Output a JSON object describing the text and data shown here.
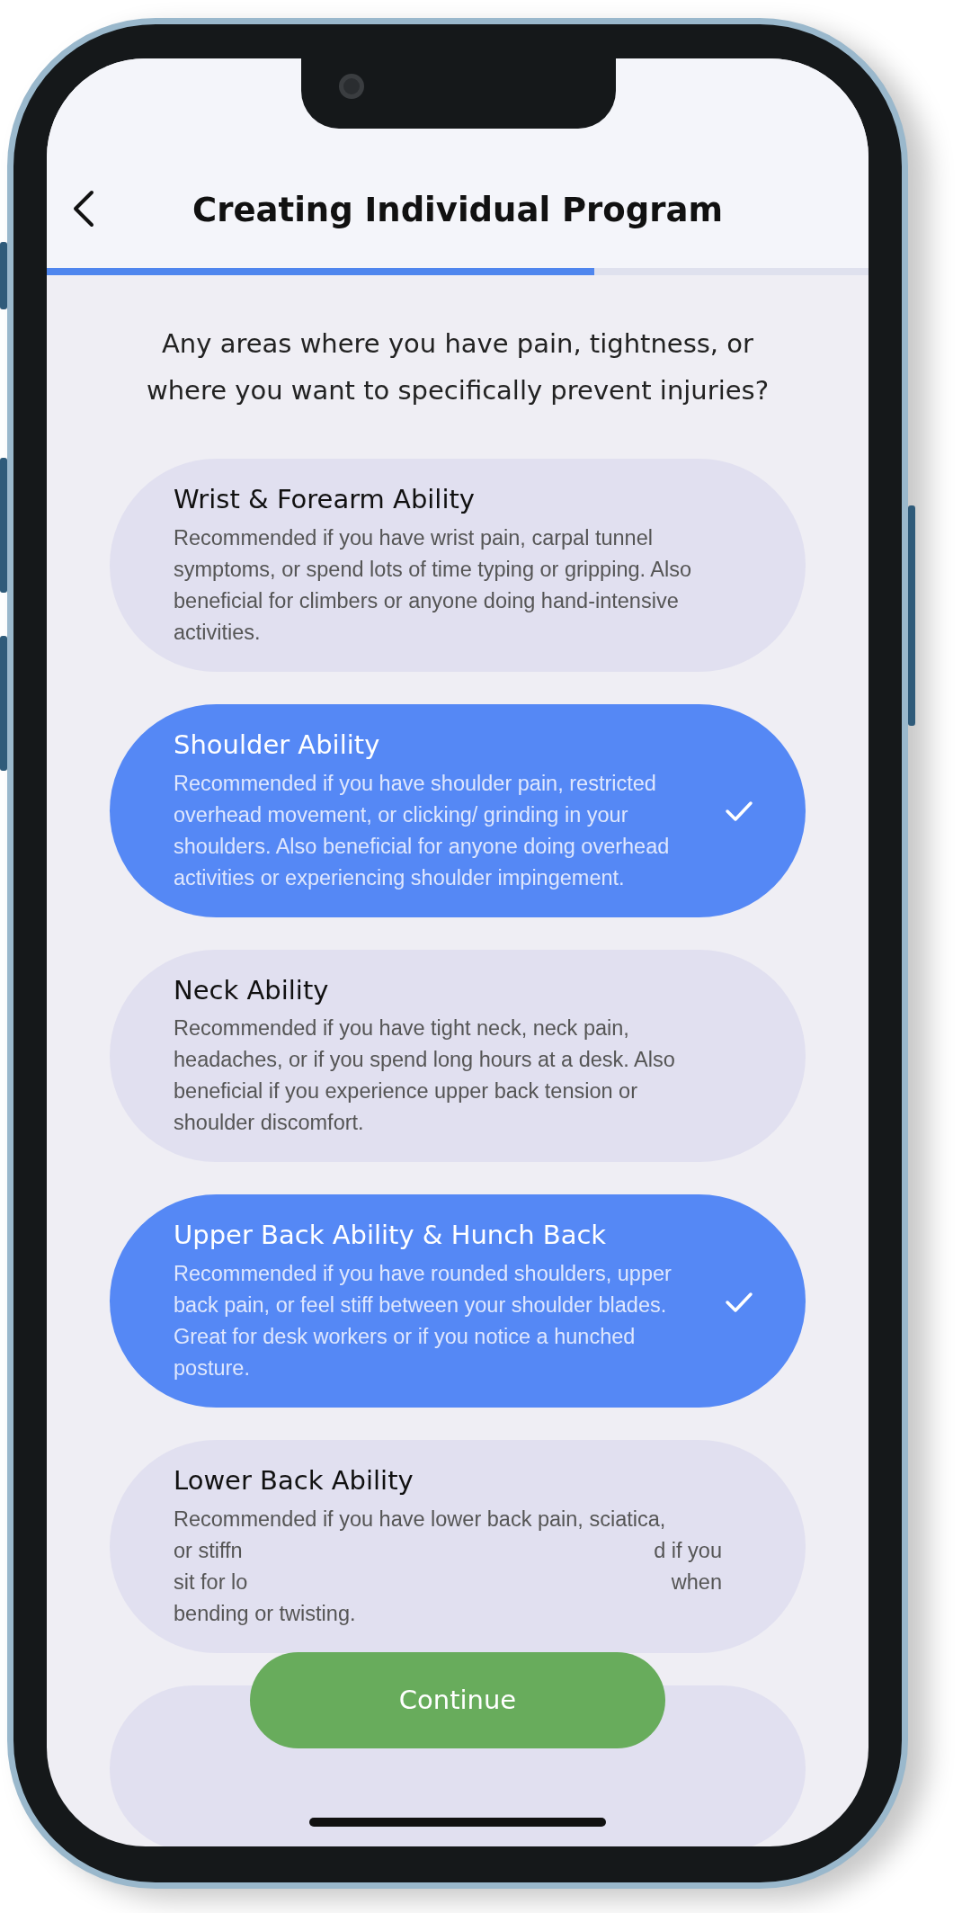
{
  "header": {
    "title": "Creating Individual Program"
  },
  "progress": {
    "level": 0.666
  },
  "question": "Any areas where you have pain, tightness, or where you want to specifically prevent injuries?",
  "options": [
    {
      "kind": "option",
      "title": "Wrist & Forearm Ability",
      "description": "Recommended if you have wrist pain, carpal tunnel symptoms, or spend lots of time typing or gripping. Also beneficial for climbers or anyone doing hand-intensive activities.",
      "selected": false
    },
    {
      "kind": "option",
      "title": "Shoulder Ability",
      "description": "Recommended if you have shoulder pain, restricted overhead movement, or clicking/ grinding in your shoulders. Also beneficial for anyone doing overhead activities or experiencing shoulder impingement.",
      "selected": true
    },
    {
      "kind": "option",
      "title": "Neck Ability",
      "description": "Recommended if you have tight neck, neck pain, headaches, or if you spend long hours at a desk. Also beneficial if you experience upper back tension or shoulder discomfort.",
      "selected": false
    },
    {
      "kind": "option",
      "title": "Upper Back Ability & Hunch Back",
      "description": "Recommended if you have rounded shoulders, upper back pain, or feel stiff between your shoulder blades. Great for desk workers or if you notice a hunched posture.",
      "selected": true
    },
    {
      "kind": "covered",
      "title": "Lower Back Ability",
      "description_lines": [
        [
          "Recommended if you have lower back pain, sciatica,"
        ],
        [
          "or stiffn",
          "d if you"
        ],
        [
          "sit for lo",
          "when"
        ],
        [
          "bending or twisting."
        ]
      ],
      "selected": false
    }
  ],
  "continue_button": "Continue"
}
